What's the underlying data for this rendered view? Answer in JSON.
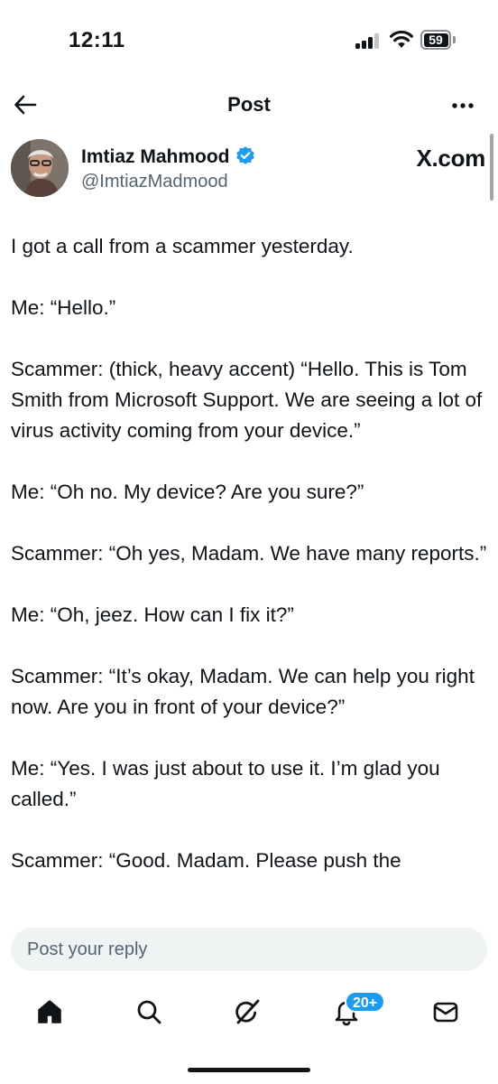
{
  "status_bar": {
    "time": "12:11",
    "battery_level": "59",
    "icons": [
      "cellular-signal-icon",
      "wifi-icon",
      "battery-icon"
    ]
  },
  "header": {
    "title": "Post",
    "icons": [
      "back-arrow-icon",
      "more-options-icon"
    ]
  },
  "author": {
    "name": "Imtiaz Mahmood",
    "handle": "@ImtiazMadmood",
    "verified": true,
    "source_label": "X.com",
    "verified_color": "#1d9bf0"
  },
  "post": {
    "paragraphs": [
      "I got a call from a scammer yesterday.",
      "Me: “Hello.”",
      "Scammer: (thick, heavy accent) “Hello. This is Tom Smith from Microsoft Support. We are seeing a lot of virus activity coming from your device.”",
      "Me: “Oh no. My device? Are you sure?”",
      "Scammer: “Oh yes, Madam. We have many reports.”",
      "Me: “Oh, jeez. How can I fix it?”",
      "Scammer: “It’s okay, Madam. We can help you right now. Are you in front of your device?”",
      "Me: “Yes. I was just about to use it. I’m glad you called.”",
      "Scammer: “Good. Madam. Please push the"
    ]
  },
  "reply": {
    "placeholder": "Post your reply"
  },
  "tab_bar": {
    "tabs": [
      {
        "icon": "home-icon"
      },
      {
        "icon": "search-icon"
      },
      {
        "icon": "grok-icon"
      },
      {
        "icon": "notifications-bell-icon"
      },
      {
        "icon": "messages-envelope-icon"
      }
    ],
    "notifications_badge": "20+",
    "badge_color": "#1d9bf0"
  },
  "colors": {
    "text": "#0f1419",
    "secondary_text": "#536471",
    "accent": "#1d9bf0",
    "input_bg": "#eff3f4"
  }
}
